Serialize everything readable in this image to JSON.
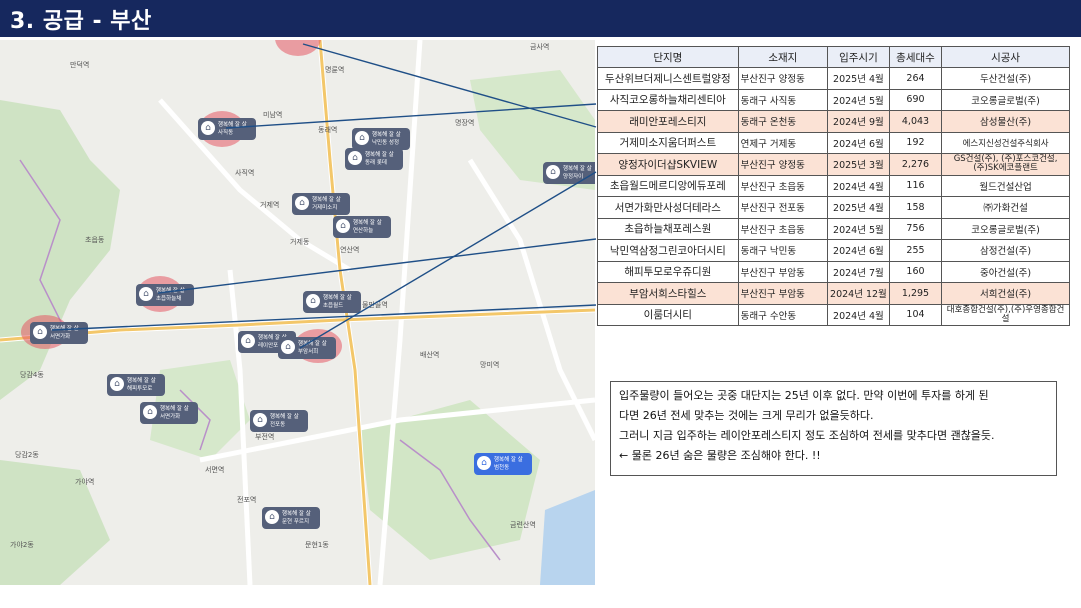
{
  "header": {
    "title": "3. 공급 - 부산"
  },
  "map": {
    "pins": [
      {
        "line1": "행복해 잘 살",
        "line2": "사직동",
        "color": "#55607a"
      },
      {
        "line1": "행복해 잘 살",
        "line2": "낙민동 성정",
        "color": "#55607a"
      },
      {
        "line1": "행복해 잘 살",
        "line2": "동래 롯데",
        "color": "#55607a"
      },
      {
        "line1": "행복해 잘 살",
        "line2": "양정자이",
        "color": "#55607a"
      },
      {
        "line1": "행복해 잘 살",
        "line2": "거제미소지",
        "color": "#55607a"
      },
      {
        "line1": "행복해 잘 살",
        "line2": "연산하늘",
        "color": "#55607a"
      },
      {
        "line1": "행복해 잘 살",
        "line2": "초읍하늘채",
        "color": "#55607a"
      },
      {
        "line1": "행복해 잘 살",
        "line2": "초읍월드",
        "color": "#55607a"
      },
      {
        "line1": "행복해 잘 살",
        "line2": "서면가화",
        "color": "#55607a"
      },
      {
        "line1": "행복해 잘 살",
        "line2": "레이안포레",
        "color": "#55607a"
      },
      {
        "line1": "행복해 잘 살",
        "line2": "부암서희",
        "color": "#55607a"
      },
      {
        "line1": "행복해 잘 살",
        "line2": "해피투모로",
        "color": "#55607a"
      },
      {
        "line1": "행복해 잘 살",
        "line2": "서면가화",
        "color": "#55607a"
      },
      {
        "line1": "행복해 잘 살",
        "line2": "전포동",
        "color": "#55607a"
      },
      {
        "line1": "행복해 잘 살",
        "line2": "문현 푸르지",
        "color": "#55607a"
      },
      {
        "line1": "행복해 잘 살",
        "line2": "범천동",
        "color": "#3a6ee0"
      }
    ]
  },
  "table": {
    "headers": [
      "단지명",
      "소재지",
      "입주시기",
      "총세대수",
      "시공사"
    ],
    "rows": [
      {
        "name": "두산위브더제니스센트럴양정",
        "location": "부산진구 양정동",
        "date": "2025년 4월",
        "units": "264",
        "builder": "두산건설(주)",
        "highlight": false
      },
      {
        "name": "사직코오롱하늘채리센티아",
        "location": "동래구 사직동",
        "date": "2024년 5월",
        "units": "690",
        "builder": "코오롱글로벌(주)",
        "highlight": false
      },
      {
        "name": "래미안포레스티지",
        "location": "동래구 온천동",
        "date": "2024년 9월",
        "units": "4,043",
        "builder": "삼성물산(주)",
        "highlight": true
      },
      {
        "name": "거제미소지움더퍼스트",
        "location": "연제구 거제동",
        "date": "2024년 6월",
        "units": "192",
        "builder": "에스지신성건설주식회사",
        "highlight": false
      },
      {
        "name": "양정자이더샵SKVIEW",
        "location": "부산진구 양정동",
        "date": "2025년 3월",
        "units": "2,276",
        "builder": "GS건설(주), (주)포스코건설, (주)SK에코플랜트",
        "highlight": true
      },
      {
        "name": "초읍월드메르디앙에듀포레",
        "location": "부산진구 초읍동",
        "date": "2024년 4월",
        "units": "116",
        "builder": "월드건설산업",
        "highlight": false
      },
      {
        "name": "서면가화만사성더테라스",
        "location": "부산진구 전포동",
        "date": "2025년 4월",
        "units": "158",
        "builder": "㈜가화건설",
        "highlight": false
      },
      {
        "name": "초읍하늘채포레스원",
        "location": "부산진구 초읍동",
        "date": "2024년 5월",
        "units": "756",
        "builder": "코오롱글로벌(주)",
        "highlight": false
      },
      {
        "name": "낙민역삼정그린코아더시티",
        "location": "동래구 낙민동",
        "date": "2024년 6월",
        "units": "255",
        "builder": "삼정건설(주)",
        "highlight": false
      },
      {
        "name": "해피투모로우쥬디원",
        "location": "부산진구 부암동",
        "date": "2024년 7월",
        "units": "160",
        "builder": "중아건설(주)",
        "highlight": false
      },
      {
        "name": "부암서희스타힐스",
        "location": "부산진구 부암동",
        "date": "2024년 12월",
        "units": "1,295",
        "builder": "서희건설(주)",
        "highlight": true
      },
      {
        "name": "이룸더시티",
        "location": "동래구 수안동",
        "date": "2024년 4월",
        "units": "104",
        "builder": "대호종합건설(주),(주)우영종합건설",
        "highlight": false
      }
    ]
  },
  "note": {
    "lines": [
      "입주물량이 들어오는 곳중 대단지는 25년 이후 없다. 만약 이번에 투자를 하게 된",
      "다면 26년 전세 맞추는 것에는 크게 무리가 없을듯하다.",
      "그러니 지금 입주하는 레이안포레스티지 정도 조심하여 전세를 맞추다면 괜찮을듯.",
      "← 물론 26년 숨은 물량은 조심해야 한다. !!"
    ]
  },
  "colors": {
    "header_bg": "#16285e",
    "highlight_row": "#fbe2d5",
    "table_header": "#eaeef7",
    "pin": "#55607a",
    "pin_blue": "#3a6ee0"
  }
}
